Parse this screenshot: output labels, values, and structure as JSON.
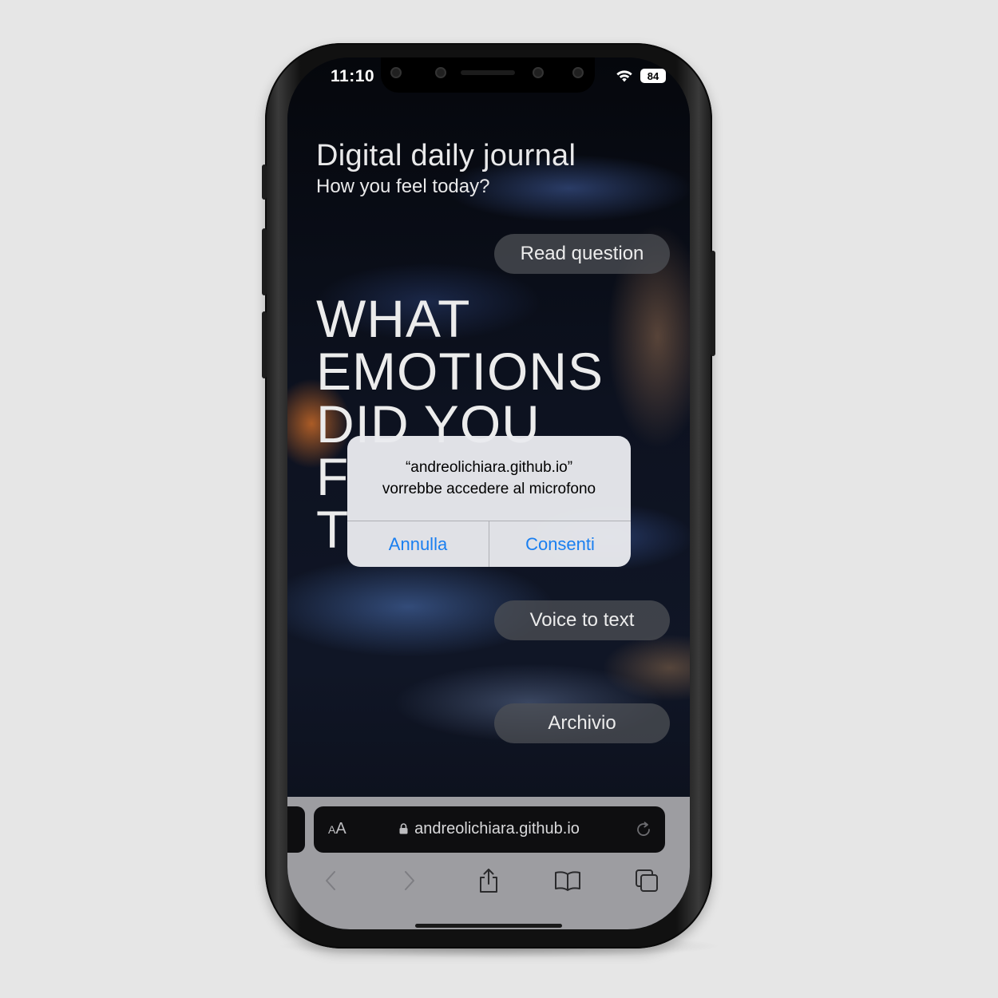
{
  "status_bar": {
    "time": "11:10",
    "battery": "84"
  },
  "app": {
    "title": "Digital daily journal",
    "subtitle": "How you feel today?",
    "read_question_label": "Read question",
    "question_lines": [
      "WHAT",
      "EMOTIONS",
      "DID YOU",
      "F",
      "T"
    ],
    "voice_to_text_label": "Voice to text",
    "archive_label": "Archivio"
  },
  "alert": {
    "line1": "“andreolichiara.github.io”",
    "line2": "vorrebbe accedere al microfono",
    "cancel_label": "Annulla",
    "allow_label": "Consenti",
    "accent_color": "#1a7ff0"
  },
  "browser": {
    "aa_large": "A",
    "aa_small": "A",
    "url": "andreolichiara.github.io",
    "toolbar_icons": [
      "back-icon",
      "forward-icon",
      "share-icon",
      "bookmarks-icon",
      "tabs-icon"
    ]
  }
}
